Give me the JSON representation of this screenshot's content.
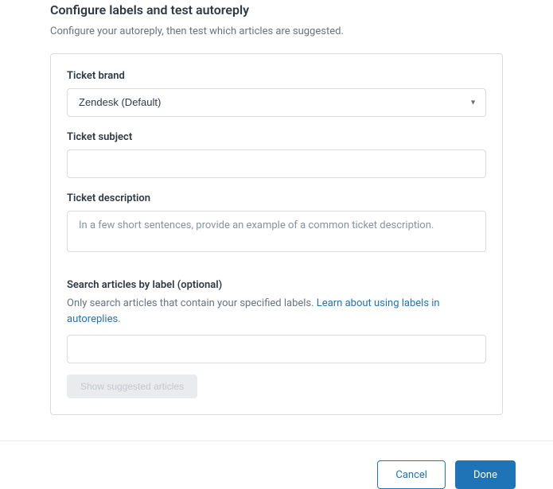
{
  "header": {
    "title": "Configure labels and test autoreply",
    "subtitle": "Configure your autoreply, then test which articles are suggested."
  },
  "form": {
    "brand": {
      "label": "Ticket brand",
      "selected": "Zendesk (Default)"
    },
    "subject": {
      "label": "Ticket subject",
      "value": ""
    },
    "description": {
      "label": "Ticket description",
      "placeholder": "In a few short sentences, provide an example of a common ticket description.",
      "value": ""
    },
    "search": {
      "label": "Search articles by label (optional)",
      "subtext_prefix": "Only search articles that contain your specified labels. ",
      "link_text": "Learn about using labels in autoreplies",
      "subtext_suffix": ".",
      "value": "",
      "button": "Show suggested articles"
    }
  },
  "footer": {
    "cancel": "Cancel",
    "done": "Done"
  }
}
